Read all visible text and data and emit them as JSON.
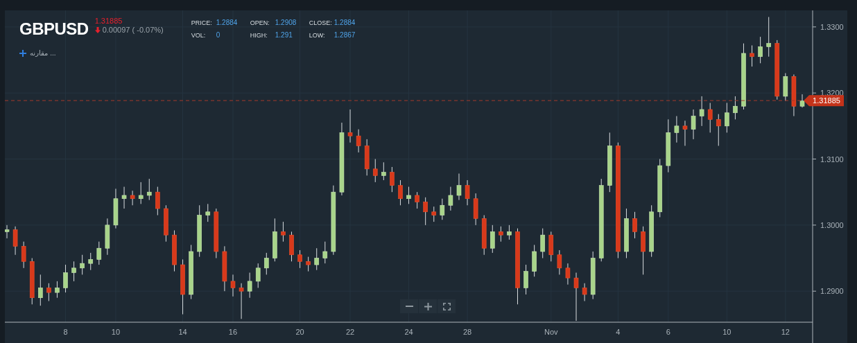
{
  "header": {
    "symbol": "GBPUSD",
    "last_price": "1.31885",
    "change": {
      "down": true,
      "text": "0.00097 ( -0.07%)"
    },
    "stats": [
      {
        "label": "PRICE:",
        "value": "1.2884"
      },
      {
        "label": "OPEN:",
        "value": "1.2908"
      },
      {
        "label": "CLOSE:",
        "value": "1.2884"
      },
      {
        "label": "VOL:",
        "value": "0"
      },
      {
        "label": "HIGH:",
        "value": "1.291"
      },
      {
        "label": "LOW:",
        "value": "1.2867"
      }
    ],
    "compare": {
      "label": "مقارنه ..."
    }
  },
  "chart": {
    "chart_data": {
      "type": "candlestick",
      "grid": true,
      "ref_lines": [
        {
          "axis": "y",
          "value": 1.31885,
          "label": "1.31885"
        }
      ],
      "ylim": [
        1.2853,
        1.3325
      ],
      "yticks": [
        {
          "value": 1.33,
          "label": "1.3300"
        },
        {
          "value": 1.32,
          "label": "1.3200"
        },
        {
          "value": 1.31,
          "label": "1.3100"
        },
        {
          "value": 1.3,
          "label": "1.3000"
        },
        {
          "value": 1.29,
          "label": "1.2900"
        }
      ],
      "categories": [
        null,
        null,
        null,
        null,
        null,
        null,
        null,
        "8",
        null,
        null,
        null,
        null,
        null,
        "10",
        null,
        null,
        null,
        null,
        null,
        null,
        null,
        "14",
        null,
        null,
        null,
        null,
        null,
        "16",
        null,
        null,
        null,
        null,
        null,
        null,
        null,
        "20",
        null,
        null,
        null,
        null,
        null,
        "22",
        null,
        null,
        null,
        null,
        null,
        null,
        "24",
        null,
        null,
        null,
        null,
        null,
        null,
        "28",
        null,
        null,
        null,
        null,
        null,
        null,
        null,
        null,
        null,
        "Nov",
        null,
        null,
        null,
        null,
        null,
        null,
        null,
        "4",
        null,
        null,
        null,
        null,
        null,
        "6",
        null,
        null,
        null,
        null,
        null,
        null,
        "10",
        null,
        null,
        null,
        null,
        null,
        null,
        "12",
        null,
        null
      ],
      "ohlc": [
        [
          1.299,
          1.3,
          1.298,
          1.2993
        ],
        [
          1.2993,
          1.2998,
          1.2955,
          1.2968
        ],
        [
          1.2968,
          1.2975,
          1.2935,
          1.2945
        ],
        [
          1.2945,
          1.295,
          1.288,
          1.289
        ],
        [
          1.289,
          1.2925,
          1.2878,
          1.2905
        ],
        [
          1.2905,
          1.2912,
          1.2885,
          1.2898
        ],
        [
          1.2898,
          1.2915,
          1.289,
          1.2905
        ],
        [
          1.2905,
          1.294,
          1.2898,
          1.2928
        ],
        [
          1.2928,
          1.2945,
          1.2915,
          1.2935
        ],
        [
          1.2935,
          1.2955,
          1.2925,
          1.2942
        ],
        [
          1.2942,
          1.2958,
          1.2932,
          1.2948
        ],
        [
          1.2948,
          1.2975,
          1.294,
          1.2965
        ],
        [
          1.2965,
          1.301,
          1.2955,
          1.3
        ],
        [
          1.3,
          1.3055,
          1.2995,
          1.304
        ],
        [
          1.304,
          1.3058,
          1.3025,
          1.3045
        ],
        [
          1.3045,
          1.3052,
          1.303,
          1.304
        ],
        [
          1.304,
          1.3065,
          1.3032,
          1.3045
        ],
        [
          1.3045,
          1.307,
          1.3038,
          1.305
        ],
        [
          1.305,
          1.3058,
          1.3015,
          1.3025
        ],
        [
          1.3025,
          1.303,
          1.2975,
          1.2985
        ],
        [
          1.2985,
          1.2992,
          1.293,
          1.294
        ],
        [
          1.294,
          1.2948,
          1.2865,
          1.2895
        ],
        [
          1.2895,
          1.297,
          1.2888,
          1.296
        ],
        [
          1.296,
          1.303,
          1.2952,
          1.3015
        ],
        [
          1.3015,
          1.3032,
          1.3005,
          1.302
        ],
        [
          1.302,
          1.3025,
          1.295,
          1.296
        ],
        [
          1.296,
          1.2968,
          1.29,
          1.2915
        ],
        [
          1.2915,
          1.2925,
          1.2892,
          1.2905
        ],
        [
          1.2905,
          1.2912,
          1.2858,
          1.29
        ],
        [
          1.29,
          1.2928,
          1.289,
          1.2915
        ],
        [
          1.2915,
          1.2942,
          1.2905,
          1.2935
        ],
        [
          1.2935,
          1.2958,
          1.2925,
          1.295
        ],
        [
          1.295,
          1.301,
          1.2945,
          1.299
        ],
        [
          1.299,
          1.3005,
          1.2975,
          1.2985
        ],
        [
          1.2985,
          1.299,
          1.2945,
          1.2955
        ],
        [
          1.2955,
          1.2962,
          1.2935,
          1.2945
        ],
        [
          1.2945,
          1.2952,
          1.293,
          1.294
        ],
        [
          1.294,
          1.2965,
          1.2932,
          1.295
        ],
        [
          1.295,
          1.2975,
          1.2942,
          1.296
        ],
        [
          1.296,
          1.306,
          1.2955,
          1.305
        ],
        [
          1.305,
          1.3155,
          1.3045,
          1.314
        ],
        [
          1.314,
          1.3175,
          1.3125,
          1.3135
        ],
        [
          1.3135,
          1.3145,
          1.311,
          1.312
        ],
        [
          1.312,
          1.313,
          1.3075,
          1.3085
        ],
        [
          1.3085,
          1.31,
          1.3065,
          1.3075
        ],
        [
          1.3075,
          1.3095,
          1.3068,
          1.308
        ],
        [
          1.308,
          1.3088,
          1.305,
          1.306
        ],
        [
          1.306,
          1.3068,
          1.303,
          1.304
        ],
        [
          1.304,
          1.3058,
          1.3032,
          1.3045
        ],
        [
          1.3045,
          1.305,
          1.3025,
          1.3035
        ],
        [
          1.3035,
          1.3042,
          1.3,
          1.302
        ],
        [
          1.302,
          1.3028,
          1.3005,
          1.3015
        ],
        [
          1.3015,
          1.304,
          1.3008,
          1.303
        ],
        [
          1.303,
          1.3058,
          1.3022,
          1.3045
        ],
        [
          1.3045,
          1.3078,
          1.3038,
          1.306
        ],
        [
          1.306,
          1.3068,
          1.303,
          1.304
        ],
        [
          1.304,
          1.3048,
          1.3,
          1.301
        ],
        [
          1.301,
          1.3015,
          1.2955,
          1.2965
        ],
        [
          1.2965,
          1.3,
          1.2958,
          1.299
        ],
        [
          1.299,
          1.2998,
          1.2975,
          1.2985
        ],
        [
          1.2985,
          1.3,
          1.2978,
          1.299
        ],
        [
          1.299,
          1.2995,
          1.288,
          1.2905
        ],
        [
          1.2905,
          1.294,
          1.2895,
          1.293
        ],
        [
          1.293,
          1.297,
          1.2922,
          1.296
        ],
        [
          1.296,
          1.2995,
          1.295,
          1.2985
        ],
        [
          1.2985,
          1.299,
          1.2945,
          1.2955
        ],
        [
          1.2955,
          1.2962,
          1.2925,
          1.2935
        ],
        [
          1.2935,
          1.2942,
          1.291,
          1.292
        ],
        [
          1.292,
          1.2928,
          1.2855,
          1.2905
        ],
        [
          1.2905,
          1.2912,
          1.2885,
          1.2895
        ],
        [
          1.2895,
          1.296,
          1.2888,
          1.295
        ],
        [
          1.295,
          1.307,
          1.2945,
          1.306
        ],
        [
          1.306,
          1.314,
          1.305,
          1.312
        ],
        [
          1.312,
          1.3125,
          1.295,
          1.296
        ],
        [
          1.296,
          1.3025,
          1.295,
          1.301
        ],
        [
          1.301,
          1.302,
          1.298,
          1.299
        ],
        [
          1.299,
          1.2998,
          1.2925,
          1.296
        ],
        [
          1.296,
          1.303,
          1.2952,
          1.302
        ],
        [
          1.302,
          1.31,
          1.3012,
          1.309
        ],
        [
          1.309,
          1.316,
          1.308,
          1.314
        ],
        [
          1.314,
          1.3165,
          1.3125,
          1.315
        ],
        [
          1.315,
          1.3158,
          1.312,
          1.3145
        ],
        [
          1.3145,
          1.3175,
          1.313,
          1.3165
        ],
        [
          1.3165,
          1.3195,
          1.315,
          1.3175
        ],
        [
          1.3175,
          1.3185,
          1.314,
          1.316
        ],
        [
          1.316,
          1.3168,
          1.312,
          1.315
        ],
        [
          1.315,
          1.3185,
          1.314,
          1.317
        ],
        [
          1.317,
          1.3195,
          1.316,
          1.318
        ],
        [
          1.318,
          1.3275,
          1.3175,
          1.326
        ],
        [
          1.326,
          1.3272,
          1.324,
          1.3255
        ],
        [
          1.3255,
          1.3285,
          1.3245,
          1.327
        ],
        [
          1.327,
          1.3315,
          1.3255,
          1.3275
        ],
        [
          1.3275,
          1.328,
          1.319,
          1.3195
        ],
        [
          1.3195,
          1.323,
          1.3188,
          1.3225
        ],
        [
          1.3225,
          1.3228,
          1.3165,
          1.318
        ],
        [
          1.318,
          1.3198,
          1.3178,
          1.3188
        ]
      ]
    }
  },
  "zoom_controls": [
    {
      "kind": "zoom-out"
    },
    {
      "kind": "zoom-in"
    },
    {
      "kind": "fullscreen"
    }
  ]
}
